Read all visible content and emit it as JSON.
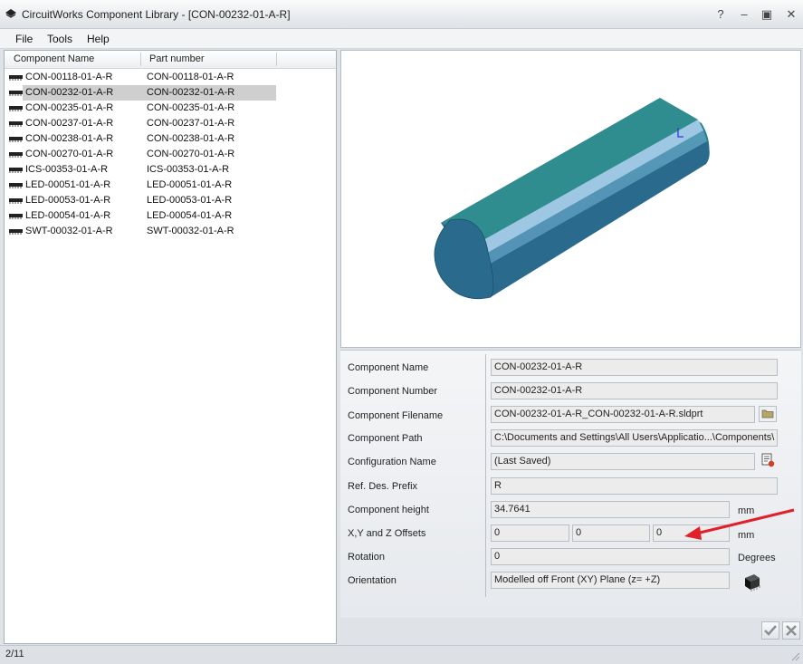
{
  "window": {
    "title": "CircuitWorks Component Library - [CON-00232-01-A-R]",
    "help": "?",
    "minimize": "–",
    "maximize": "▣",
    "close": "✕"
  },
  "menu": [
    "File",
    "Tools",
    "Help"
  ],
  "list": {
    "columns": [
      "Component Name",
      "Part number"
    ],
    "selected_index": 1,
    "rows": [
      {
        "name": "CON-00118-01-A-R",
        "part": "CON-00118-01-A-R"
      },
      {
        "name": "CON-00232-01-A-R",
        "part": "CON-00232-01-A-R"
      },
      {
        "name": "CON-00235-01-A-R",
        "part": "CON-00235-01-A-R"
      },
      {
        "name": "CON-00237-01-A-R",
        "part": "CON-00237-01-A-R"
      },
      {
        "name": "CON-00238-01-A-R",
        "part": "CON-00238-01-A-R"
      },
      {
        "name": "CON-00270-01-A-R",
        "part": "CON-00270-01-A-R"
      },
      {
        "name": "ICS-00353-01-A-R",
        "part": "ICS-00353-01-A-R"
      },
      {
        "name": "LED-00051-01-A-R",
        "part": "LED-00051-01-A-R"
      },
      {
        "name": "LED-00053-01-A-R",
        "part": "LED-00053-01-A-R"
      },
      {
        "name": "LED-00054-01-A-R",
        "part": "LED-00054-01-A-R"
      },
      {
        "name": "SWT-00032-01-A-R",
        "part": "SWT-00032-01-A-R"
      }
    ]
  },
  "props": {
    "component_name": {
      "label": "Component Name",
      "value": "CON-00232-01-A-R"
    },
    "component_number": {
      "label": "Component Number",
      "value": "CON-00232-01-A-R"
    },
    "component_filename": {
      "label": "Component Filename",
      "value": "CON-00232-01-A-R_CON-00232-01-A-R.sldprt"
    },
    "component_path": {
      "label": "Component Path",
      "value": "C:\\Documents and Settings\\All Users\\Applicatio...\\Components\\"
    },
    "configuration_name": {
      "label": "Configuration Name",
      "value": "(Last Saved)"
    },
    "ref_des_prefix": {
      "label": "Ref. Des. Prefix",
      "value": "R"
    },
    "component_height": {
      "label": "Component height",
      "value": "34.7641",
      "unit": "mm"
    },
    "offsets": {
      "label": "X,Y and Z Offsets",
      "x": "0",
      "y": "0",
      "z": "0",
      "unit": "mm"
    },
    "rotation": {
      "label": "Rotation",
      "value": "0",
      "unit": "Degrees"
    },
    "orientation": {
      "label": "Orientation",
      "value": "Modelled off Front (XY) Plane (z= +Z)"
    }
  },
  "status": {
    "count": "2/11"
  },
  "colors": {
    "model_teal": "#2f8c8f",
    "model_blue": "#2a6a8c",
    "highlight": "#9ec7e3",
    "arrow": "#e0202a",
    "selection": "#cfcfcf"
  }
}
